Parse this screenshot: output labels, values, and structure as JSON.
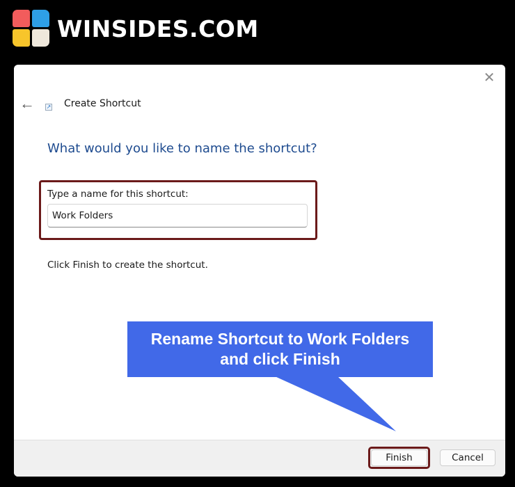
{
  "brand": {
    "name": "WINSIDES.COM"
  },
  "dialog": {
    "title": "Create Shortcut",
    "heading": "What would you like to name the shortcut?",
    "field_label": "Type a name for this shortcut:",
    "name_value": "Work Folders",
    "info": "Click Finish to create the shortcut.",
    "buttons": {
      "finish": "Finish",
      "cancel": "Cancel"
    },
    "icons": {
      "back": "back-arrow-icon",
      "close": "close-icon",
      "title": "shortcut-icon"
    }
  },
  "callout": {
    "text": "Rename Shortcut to Work Folders\nand click Finish"
  },
  "colors": {
    "callout": "#4169e8",
    "highlight_border": "#6b1a1a",
    "heading": "#1e4b8f"
  }
}
